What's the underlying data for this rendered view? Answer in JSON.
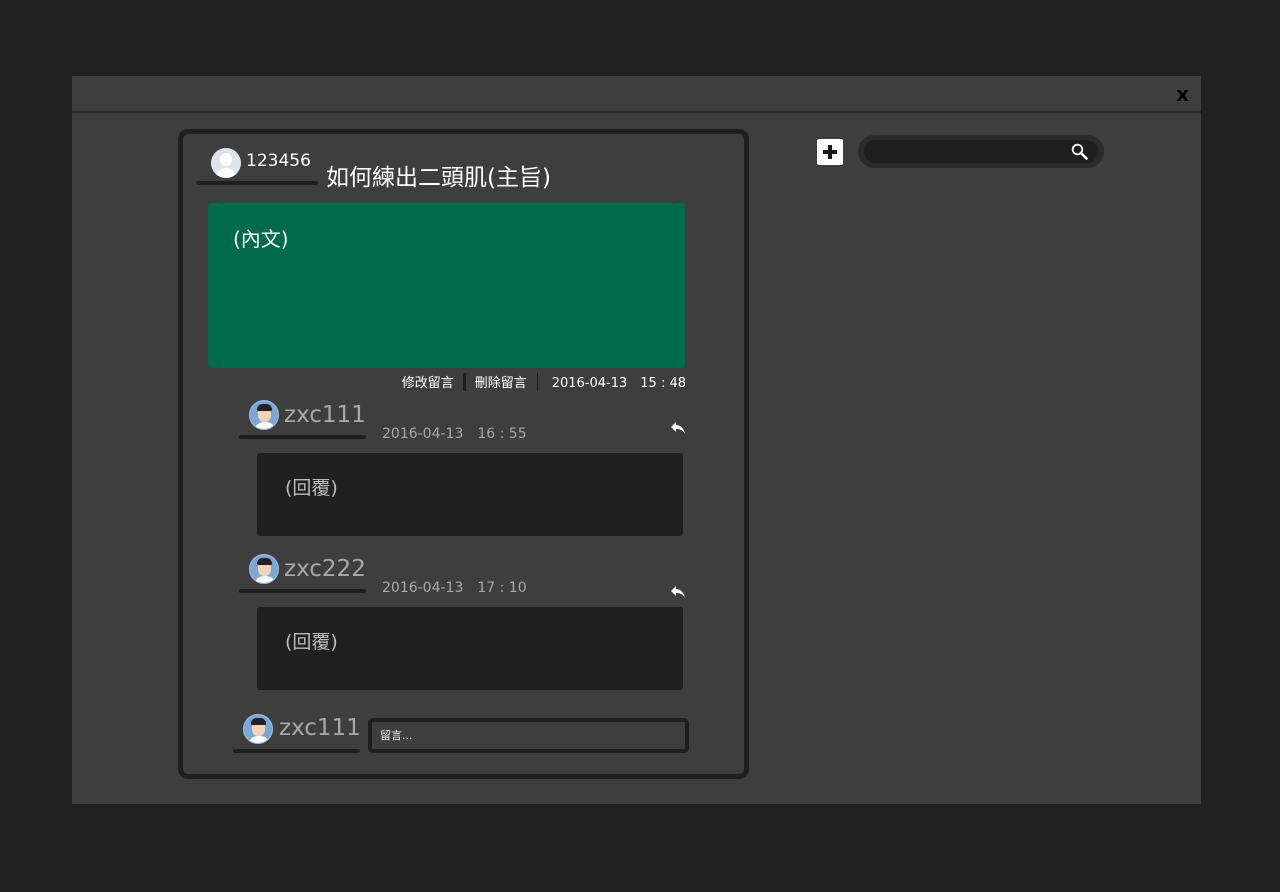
{
  "modal": {
    "close_label": "x"
  },
  "post": {
    "author": "123456",
    "title": "如何練出二頭肌(主旨)",
    "body": "(內文)",
    "edit_label": "修改留言",
    "delete_label": "刪除留言",
    "timestamp": "2016-04-13　15 : 48"
  },
  "replies": [
    {
      "author": "zxc111",
      "timestamp": "2016-04-13　16 : 55",
      "body": "(回覆)"
    },
    {
      "author": "zxc222",
      "timestamp": "2016-04-13　17 : 10",
      "body": "(回覆)"
    }
  ],
  "comment": {
    "author": "zxc111",
    "placeholder": "留言..."
  },
  "search": {
    "placeholder": ""
  },
  "colors": {
    "page_bg": "#212121",
    "modal_bg": "#3e3e3e",
    "post_body": "#006b4a",
    "reply_body": "#202020"
  }
}
